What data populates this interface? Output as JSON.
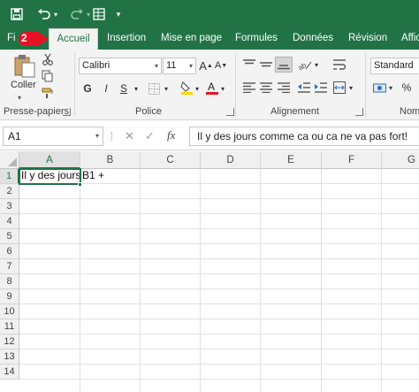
{
  "quick_access": {
    "save_icon": "save-icon",
    "undo_icon": "undo-icon",
    "redo_icon": "redo-icon",
    "form_icon": "form-icon",
    "customize_icon": "chevron-down-icon"
  },
  "tabs": [
    {
      "label": "Fi",
      "active": false
    },
    {
      "label": "Accueil",
      "active": true
    },
    {
      "label": "Insertion",
      "active": false
    },
    {
      "label": "Mise en page",
      "active": false
    },
    {
      "label": "Formules",
      "active": false
    },
    {
      "label": "Données",
      "active": false
    },
    {
      "label": "Révision",
      "active": false
    },
    {
      "label": "Affic",
      "active": false
    }
  ],
  "callout": {
    "number": "2",
    "color": "#e81123"
  },
  "ribbon": {
    "clipboard": {
      "paste_label": "Coller",
      "group_label": "Presse-papiers"
    },
    "font": {
      "font_name": "Calibri",
      "font_size": "11",
      "bold": "G",
      "italic": "I",
      "underline": "S",
      "group_label": "Police"
    },
    "alignment": {
      "group_label": "Alignement"
    },
    "number": {
      "format": "Standard",
      "group_label": "Nom"
    }
  },
  "formula_bar": {
    "name_box": "A1",
    "fx_label": "fx",
    "formula": "Il y des jours comme ca ou ca ne va pas fort!"
  },
  "grid": {
    "columns": [
      "A",
      "B",
      "C",
      "D",
      "E",
      "F",
      "G"
    ],
    "rows": [
      "1",
      "2",
      "3",
      "4",
      "5",
      "6",
      "7",
      "8",
      "9",
      "10",
      "11",
      "12",
      "13",
      "14"
    ],
    "cells": {
      "A1": "Il y des jours",
      "B1": "B1 +"
    }
  },
  "colors": {
    "excel_green": "#217346",
    "ribbon_bg": "#f3f3f3",
    "selection": "#217346"
  }
}
